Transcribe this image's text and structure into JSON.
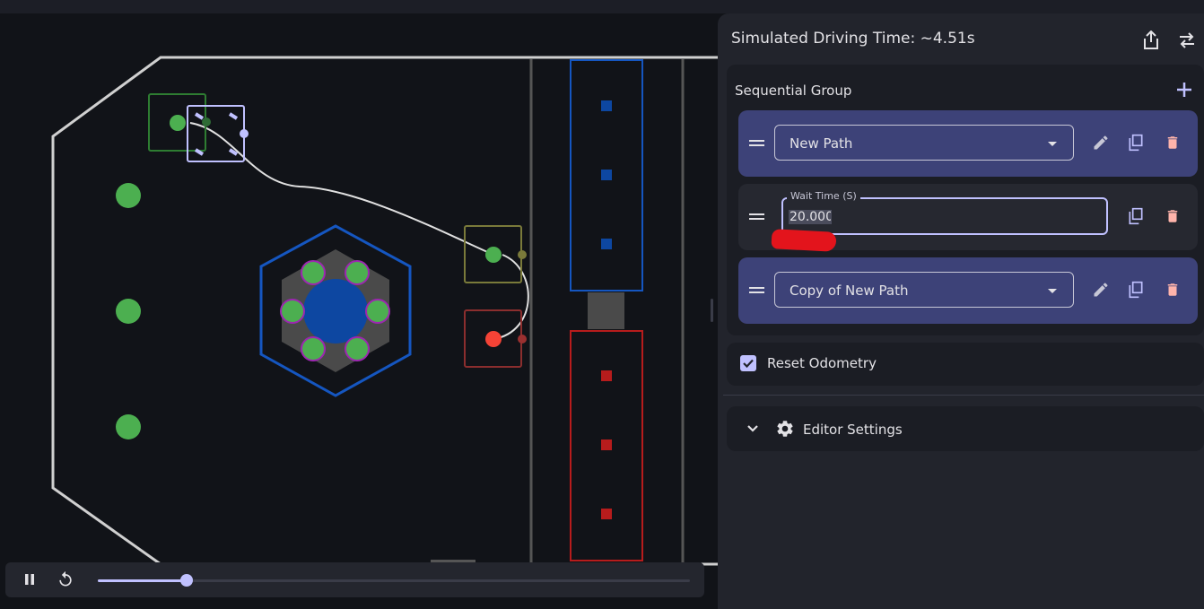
{
  "header": {
    "title": "Simulated Driving Time: ~4.51s",
    "share_icon": "share-icon",
    "swap_icon": "swap-horizontal-icon"
  },
  "group": {
    "title": "Sequential Group",
    "add_icon": "plus-icon",
    "commands": [
      {
        "type": "path",
        "value": "New Path"
      },
      {
        "type": "wait",
        "label": "Wait Time (S)",
        "value": "20.000"
      },
      {
        "type": "path",
        "value": "Copy of New Path"
      }
    ]
  },
  "reset_odometry": {
    "label": "Reset Odometry",
    "checked": true
  },
  "editor_settings": {
    "label": "Editor Settings",
    "icon": "gear-icon"
  },
  "playback": {
    "state": "playing",
    "progress": 0.15
  },
  "colors": {
    "accent": "#c0c1ff",
    "path_card": "#3d4278",
    "delete": "#ffb4ab",
    "blue_alliance": "#0d47a1",
    "red_alliance": "#b71c1c",
    "game_piece": "#4caf50"
  }
}
